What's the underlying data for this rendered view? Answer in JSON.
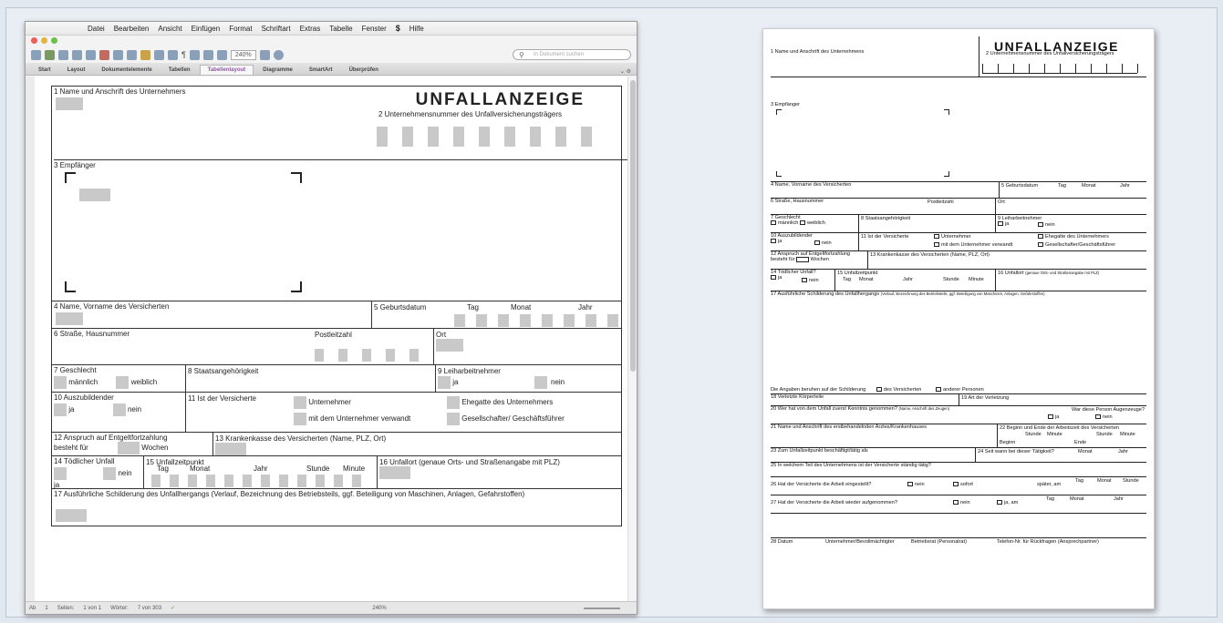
{
  "editor": {
    "menu": [
      "Datei",
      "Bearbeiten",
      "Ansicht",
      "Einfügen",
      "Format",
      "Schriftart",
      "Extras",
      "Tabelle",
      "Fenster",
      "Hilfe"
    ],
    "search_placeholder": "In Dokument suchen",
    "zoom_box": "240%",
    "ribbon_tabs": [
      "Start",
      "Layout",
      "Dokumentelemente",
      "Tabellen",
      "Tabellenlayout",
      "Diagramme",
      "SmartArt",
      "Überprüfen"
    ],
    "active_tab_index": 4,
    "status": {
      "ansicht": "Ab",
      "section": "1",
      "seiten_label": "Seiten:",
      "seiten": "1 von 1",
      "woerter_label": "Wörter:",
      "woerter": "7 von 303",
      "zoom": "240%"
    }
  },
  "left_form": {
    "title": "UNFALLANZEIGE",
    "f1": "1 Name und Anschrift des Unternehmers",
    "f2": "2 Unternehmensnummer des Unfallversicherungsträgers",
    "f3": "3 Empfänger",
    "f4": "4 Name, Vorname des Versicherten",
    "f5": "5 Geburtsdatum",
    "tag": "Tag",
    "monat": "Monat",
    "jahr": "Jahr",
    "f6": "6 Straße, Hausnummer",
    "plz": "Postleitzahl",
    "ort": "Ort",
    "f7": "7 Geschlecht",
    "maennlich": "männlich",
    "weiblich": "weiblich",
    "f8": "8 Staatsangehörigkeit",
    "f9": "9 Leiharbeitnehmer",
    "ja": "ja",
    "nein": "nein",
    "f10": "10 Auszubildender",
    "f11": "11 Ist der Versicherte",
    "unternehmer": "Unternehmer",
    "verwandt": "mit dem Unternehmer verwandt",
    "ehegatte": "Ehegatte des Unternehmers",
    "gesellschafter": "Gesellschafter/ Geschäftsführer",
    "f12a": "12 Anspruch auf Entgeltfortzahlung",
    "f12b": "besteht für",
    "wochen": "Wochen",
    "f13": "13 Krankenkasse des Versicherten (Name, PLZ, Ort)",
    "f14": "14 Tödlicher Unfall",
    "f15": "15 Unfallzeitpunkt",
    "stunde": "Stunde",
    "minute": "Minute",
    "f16": "16 Unfallort (genaue Orts- und Straßenangabe mit PLZ)",
    "f17": "17 Ausführliche Schilderung des Unfallhergangs (Verlauf, Bezeichnung des Betriebsteils, ggf. Beteiligung von Maschinen, Anlagen, Gefahrstoffen)"
  },
  "right_form": {
    "title": "UNFALLANZEIGE",
    "f1": "1 Name und Anschrift des Unternehmens",
    "f2": "2 Unternehmensnummer des Unfallversicherungsträgers",
    "f3": "3 Empfänger",
    "f4": "4 Name, Vorname des Versicherten",
    "f5": "5 Geburtsdatum",
    "tag": "Tag",
    "monat": "Monat",
    "jahr": "Jahr",
    "f6": "6 Straße, Hausnummer",
    "plz": "Postleitzahl",
    "ort": "Ort",
    "f7": "7 Geschlecht",
    "maennlich": "männlich",
    "weiblich": "weiblich",
    "f8": "8 Staatsangehörigkeit",
    "f9": "9 Leiharbeitnehmer",
    "ja": "ja",
    "nein": "nein",
    "f10": "10 Auszubildender",
    "f11": "11 Ist der Versicherte",
    "unternehmer": "Unternehmer",
    "verwandt": "mit dem Unternehmer verwandt",
    "ehegatte": "Ehegatte des Unternehmers",
    "gesellschafter": "Gesellschafter/Geschäftsführer",
    "f12a": "12 Anspruch auf Entgeltfortzahlung",
    "f12b": "besteht für",
    "wochen": "Wochen",
    "f13": "13 Krankenkasse des Versicherten (Name, PLZ, Ort)",
    "f14": "14 Tödlicher Unfall?",
    "f15": "15 Unfallzeitpunkt",
    "stunde": "Stunde",
    "minute": "Minute",
    "f16": "16 Unfallort",
    "f16b": "(genaue Orts- und Straßenangabe mit PLZ)",
    "f17": "17 Ausführliche Schilderung des Unfallhergangs",
    "f17b": "(Verlauf, Bezeichnung des Betriebsteils, ggf. Beteiligung von Maschinen, Anlagen, Gefahrstoffen)",
    "angaben": "Die Angaben beruhen auf der Schilderung",
    "des_vers": "des Versicherten",
    "andere": "anderer Personen",
    "f18": "18 Verletzte Körperteile",
    "f19": "19 Art der Verletzung",
    "f20": "20 Wer hat von dem Unfall zuerst Kenntnis genommen?",
    "f20b": "(Name, Anschrift des Zeugen)",
    "augenzeuge": "War diese Person Augenzeuge?",
    "f21": "21 Name und Anschrift des erstbehandelnden Arztes/Krankenhauses",
    "f22": "22 Beginn und Ende der Arbeitszeit des Versicherten",
    "beginn": "Beginn",
    "ende": "Ende",
    "f23": "23 Zum Unfallzeitpunkt beschäftigt/tätig als",
    "f24": "24 Seit wann bei dieser Tätigkeit?",
    "f25": "25 In welchem Teil des Unternehmens ist der Versicherte ständig tätig?",
    "f26": "26 Hat der Versicherte die Arbeit eingestellt?",
    "sofort": "sofort",
    "spaeter": "später, am",
    "f27": "27 Hat der Versicherte die Arbeit wieder aufgenommen?",
    "ja_am": "ja, am",
    "f28": "28 Datum",
    "unternehmer_bev": "Unternehmer/Bevollmächtigter",
    "betriebsrat": "Betriebsrat (Personalrat)",
    "telefon": "Telefon-Nr. für Rückfragen (Ansprechpartner)"
  }
}
